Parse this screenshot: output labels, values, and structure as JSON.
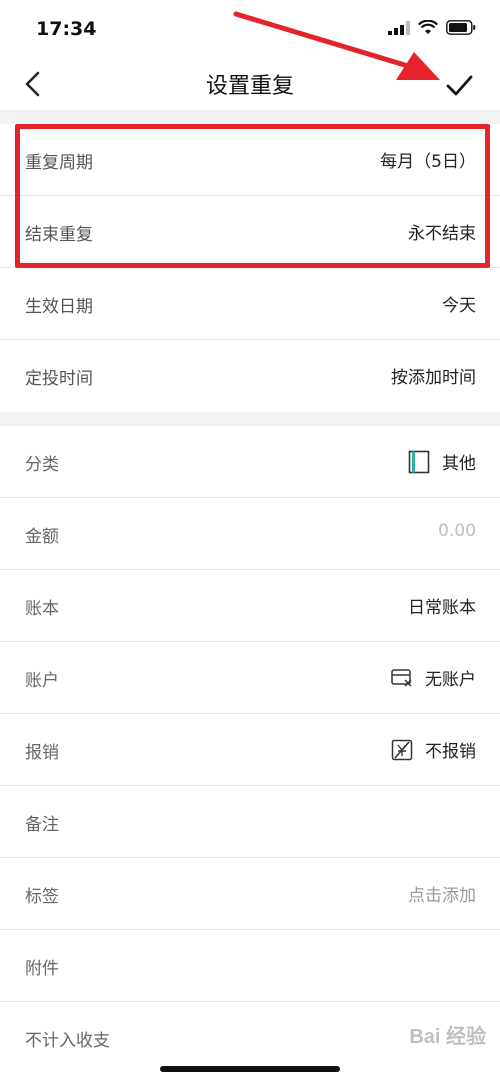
{
  "status_bar": {
    "time": "17:34"
  },
  "nav": {
    "title": "设置重复"
  },
  "section1": [
    {
      "label": "重复周期",
      "value": "每月（5日）"
    },
    {
      "label": "结束重复",
      "value": "永不结束"
    },
    {
      "label": "生效日期",
      "value": "今天"
    },
    {
      "label": "定投时间",
      "value": "按添加时间"
    }
  ],
  "section2": {
    "category": {
      "label": "分类",
      "value": "其他",
      "icon": "book-icon"
    },
    "amount": {
      "label": "金额",
      "value": "0.00"
    },
    "ledger": {
      "label": "账本",
      "value": "日常账本"
    },
    "account": {
      "label": "账户",
      "value": "无账户",
      "icon": "card-x-icon"
    },
    "reimburse": {
      "label": "报销",
      "value": "不报销",
      "icon": "no-reimburse-icon"
    },
    "note": {
      "label": "备注",
      "value": ""
    },
    "tags": {
      "label": "标签",
      "value": "点击添加"
    },
    "attachment": {
      "label": "附件",
      "value": ""
    },
    "exclude": {
      "label": "不计入收支",
      "value": ""
    }
  },
  "watermark": "Bai 经验",
  "colors": {
    "highlight": "#e5232b",
    "arrow": "#e5232b"
  }
}
